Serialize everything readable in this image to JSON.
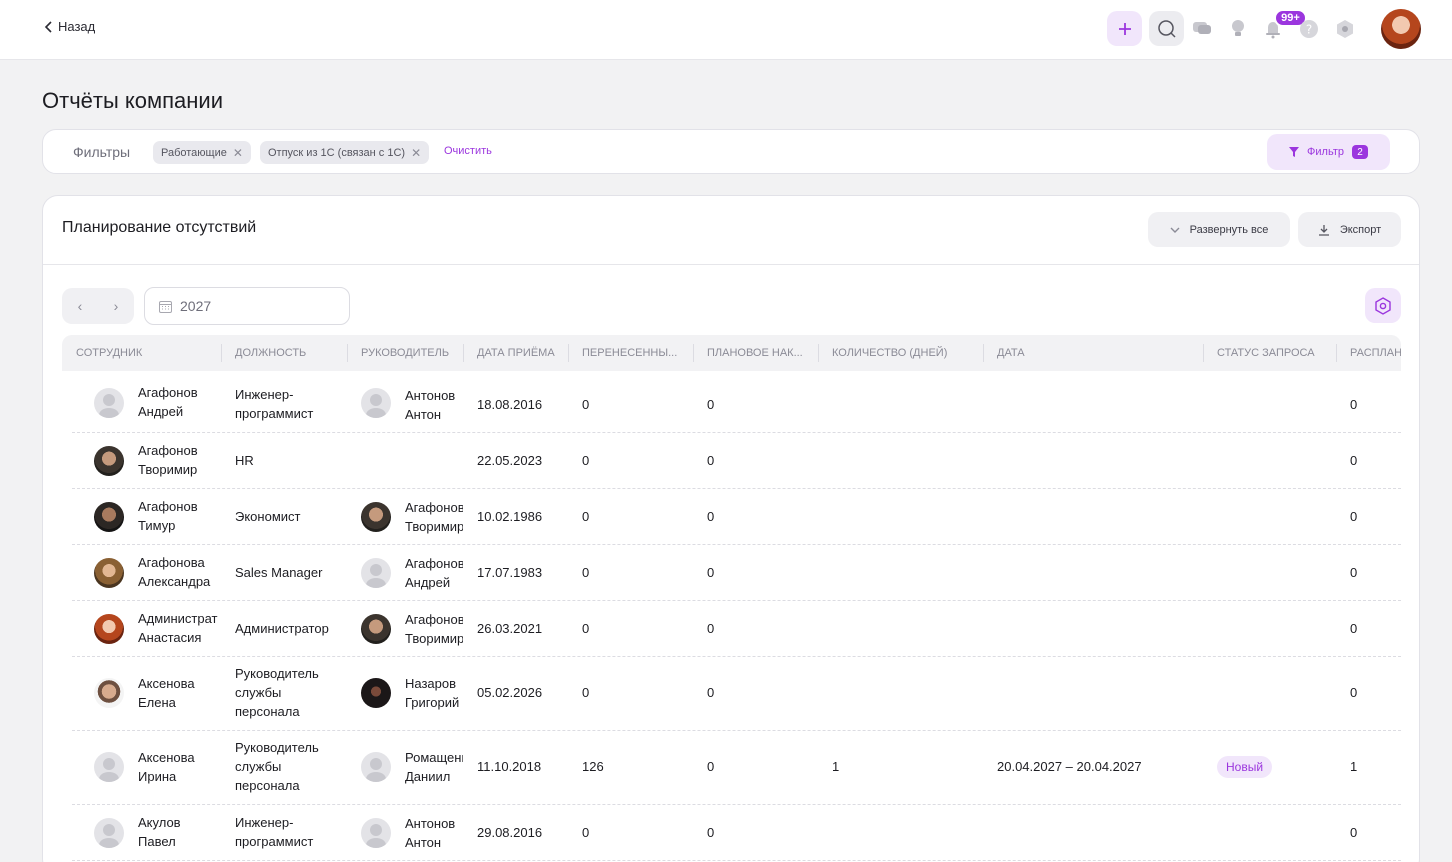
{
  "topbar": {
    "back_label": "Назад",
    "add_icon": "plus-icon",
    "notifications_badge": "99+",
    "icons": [
      "search-icon",
      "chat-icon",
      "lightbulb-icon",
      "bell-icon",
      "help-icon",
      "settings-hex-icon"
    ]
  },
  "page": {
    "title": "Отчёты компании"
  },
  "filters": {
    "label": "Фильтры",
    "chips": [
      "Работающие",
      "Отпуск из 1С (связан с 1С)"
    ],
    "clear_label": "Очистить",
    "filter_button_label": "Фильтр",
    "filter_count": "2"
  },
  "report": {
    "title": "Планирование отсутствий",
    "expand_label": "Развернуть все",
    "export_label": "Экспорт",
    "year": "2027",
    "columns": [
      "Сотрудник",
      "Должность",
      "Руководитель",
      "Дата приёма",
      "Перенесенны...",
      "Плановое нак...",
      "Количество (дней)",
      "Дата",
      "Статус запроса",
      "Распланир"
    ],
    "rows": [
      {
        "emp1": "Агафонов",
        "emp2": "Андрей",
        "pos1": "Инженер-",
        "pos2": "программист",
        "pos3": "",
        "mgr1": "Антонов",
        "mgr2": "Антон",
        "hire": "18.08.2016",
        "carried": "0",
        "planned": "0",
        "days": "",
        "date": "",
        "status": "",
        "scheduled": "0"
      },
      {
        "emp1": "Агафонов",
        "emp2": "Творимир",
        "pos1": "HR",
        "pos2": "",
        "pos3": "",
        "mgr1": "",
        "mgr2": "",
        "hire": "22.05.2023",
        "carried": "0",
        "planned": "0",
        "days": "",
        "date": "",
        "status": "",
        "scheduled": "0"
      },
      {
        "emp1": "Агафонов",
        "emp2": "Тимур",
        "pos1": "Экономист",
        "pos2": "",
        "pos3": "",
        "mgr1": "Агафонов",
        "mgr2": "Творимир",
        "hire": "10.02.1986",
        "carried": "0",
        "planned": "0",
        "days": "",
        "date": "",
        "status": "",
        "scheduled": "0"
      },
      {
        "emp1": "Агафонова",
        "emp2": "Александра",
        "pos1": "Sales Manager",
        "pos2": "",
        "pos3": "",
        "mgr1": "Агафонов",
        "mgr2": "Андрей",
        "hire": "17.07.1983",
        "carried": "0",
        "planned": "0",
        "days": "",
        "date": "",
        "status": "",
        "scheduled": "0"
      },
      {
        "emp1": "Администрат",
        "emp2": "Анастасия",
        "pos1": "Администратор",
        "pos2": "",
        "pos3": "",
        "mgr1": "Агафонов",
        "mgr2": "Творимир",
        "hire": "26.03.2021",
        "carried": "0",
        "planned": "0",
        "days": "",
        "date": "",
        "status": "",
        "scheduled": "0"
      },
      {
        "emp1": "Аксенова",
        "emp2": "Елена",
        "pos1": "Руководитель",
        "pos2": "службы",
        "pos3": "персонала",
        "mgr1": "Назаров",
        "mgr2": "Григорий",
        "hire": "05.02.2026",
        "carried": "0",
        "planned": "0",
        "days": "",
        "date": "",
        "status": "",
        "scheduled": "0"
      },
      {
        "emp1": "Аксенова",
        "emp2": "Ирина",
        "pos1": "Руководитель",
        "pos2": "службы",
        "pos3": "персонала",
        "mgr1": "Ромащенко",
        "mgr2": "Даниил",
        "hire": "11.10.2018",
        "carried": "126",
        "planned": "0",
        "days": "1",
        "date": "20.04.2027 – 20.04.2027",
        "status": "Новый",
        "scheduled": "1"
      },
      {
        "emp1": "Акулов",
        "emp2": "Павел",
        "pos1": "Инженер-",
        "pos2": "программист",
        "pos3": "",
        "mgr1": "Антонов",
        "mgr2": "Антон",
        "hire": "29.08.2016",
        "carried": "0",
        "planned": "0",
        "days": "",
        "date": "",
        "status": "",
        "scheduled": "0"
      }
    ]
  },
  "colors": {
    "accent": "#9b36de",
    "accent_soft": "#f1e6fb",
    "background": "#f2f2f3"
  }
}
